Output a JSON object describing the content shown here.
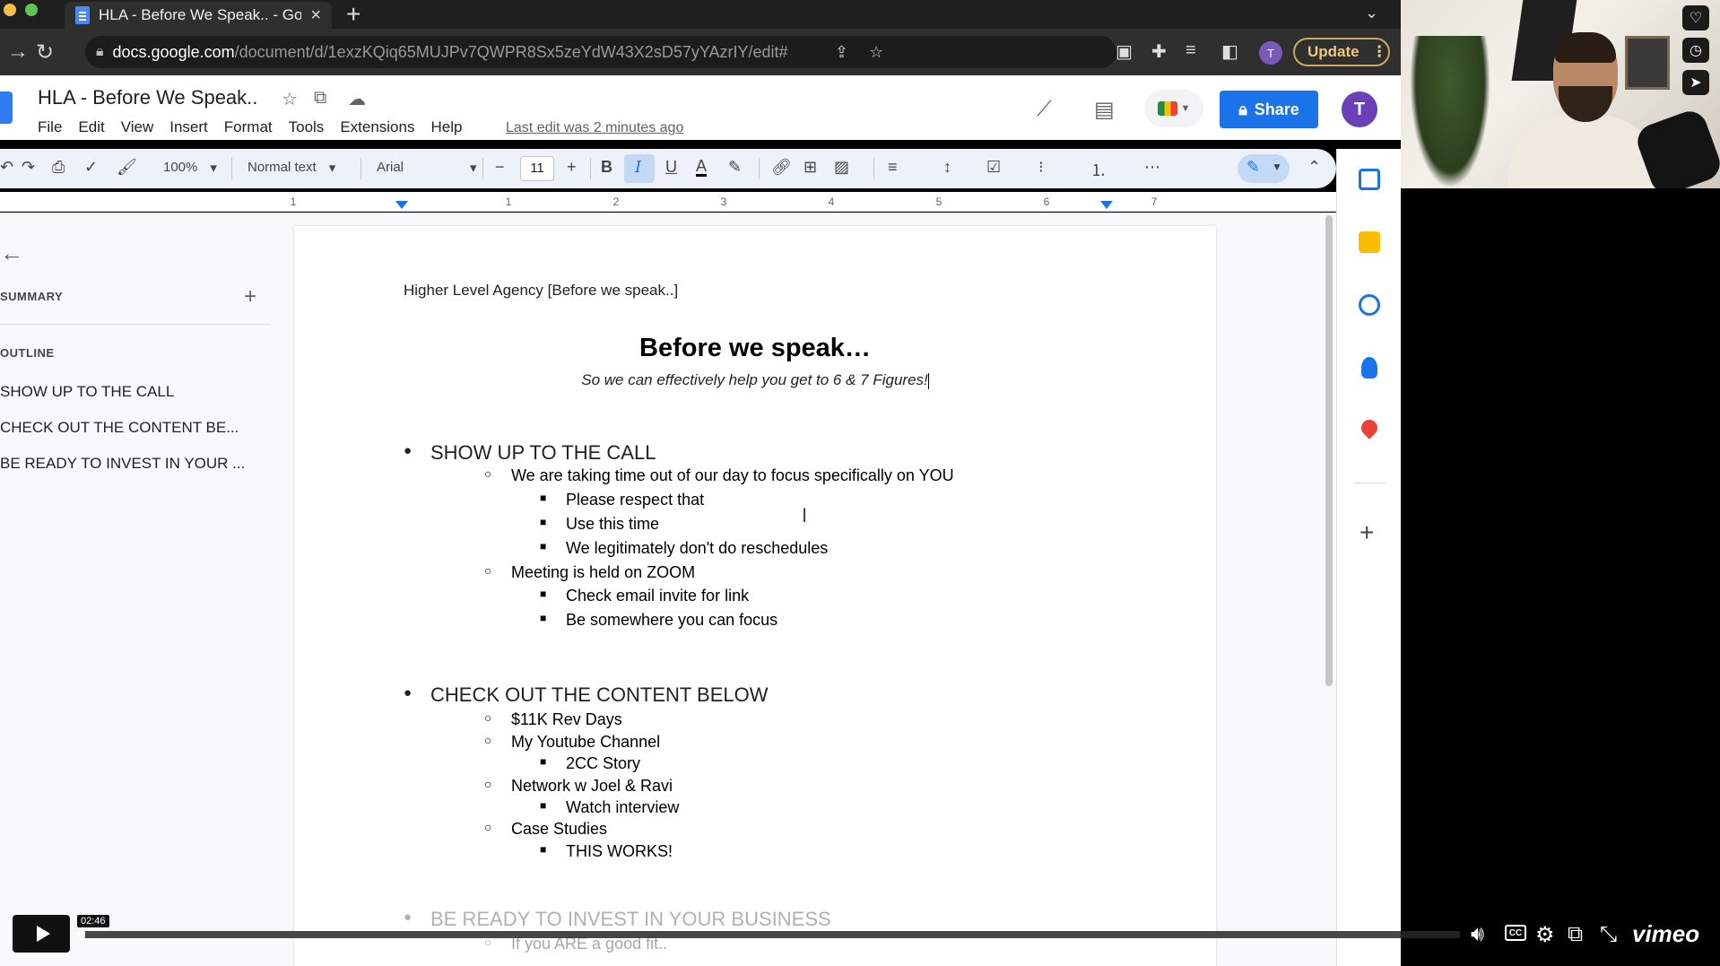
{
  "browser": {
    "tab_title": "HLA - Before We Speak.. - Goo",
    "url_domain": "docs.google.com",
    "url_path": "/document/d/1exzKQiq65MUJPv7QWPR8Sx5zeYdW43X2sD57yYAzrIY/edit#",
    "update_label": "Update",
    "profile_initial": "T"
  },
  "docs": {
    "title": "HLA - Before We Speak..",
    "menu": [
      "File",
      "Edit",
      "View",
      "Insert",
      "Format",
      "Tools",
      "Extensions",
      "Help"
    ],
    "last_edit": "Last edit was 2 minutes ago",
    "share_label": "Share",
    "avatar_initial": "T"
  },
  "toolbar": {
    "zoom": "100%",
    "style": "Normal text",
    "font": "Arial",
    "font_size": "11",
    "bold": "B",
    "italic": "I",
    "underline": "U",
    "text_color": "A"
  },
  "ruler": {
    "numbers": [
      "1",
      "1",
      "2",
      "3",
      "4",
      "5",
      "6",
      "7"
    ]
  },
  "outline_panel": {
    "summary_label": "SUMMARY",
    "outline_label": "OUTLINE",
    "items": [
      "SHOW UP TO THE CALL",
      "CHECK OUT THE CONTENT BE...",
      "BE READY TO INVEST IN YOUR ..."
    ]
  },
  "document": {
    "header": "Higher Level Agency [Before we speak..]",
    "heading": "Before we speak…",
    "subtitle": "So we can effectively help you get to 6 & 7 Figures!",
    "sections": [
      {
        "title": "SHOW UP TO THE CALL",
        "items": [
          {
            "text": "We are taking time out of our day to focus specifically on YOU",
            "children": [
              "Please respect that",
              "Use this time",
              "We legitimately don't do reschedules"
            ]
          },
          {
            "text": "Meeting is held on ZOOM",
            "children": [
              "Check email invite for link",
              "Be somewhere you can focus"
            ]
          }
        ]
      },
      {
        "title": "CHECK OUT THE CONTENT BELOW",
        "items": [
          {
            "text": "$11K Rev Days",
            "children": []
          },
          {
            "text": "My Youtube Channel",
            "children": [
              "2CC Story"
            ]
          },
          {
            "text": "Network w Joel & Ravi",
            "children": [
              "Watch interview"
            ]
          },
          {
            "text": "Case Studies",
            "children": [
              "THIS WORKS!"
            ]
          }
        ]
      },
      {
        "title": "BE READY TO INVEST IN YOUR BUSINESS",
        "items": [
          {
            "text": "If you ARE a good fit..",
            "children": []
          }
        ]
      }
    ]
  },
  "player": {
    "timestamp": "02:46",
    "progress": 0.006,
    "brand": "vimeo",
    "cc_label": "CC"
  },
  "colors": {
    "share_blue": "#1a73e8",
    "avatar_purple": "#6b3fb5",
    "update_gold": "#f1c779"
  }
}
